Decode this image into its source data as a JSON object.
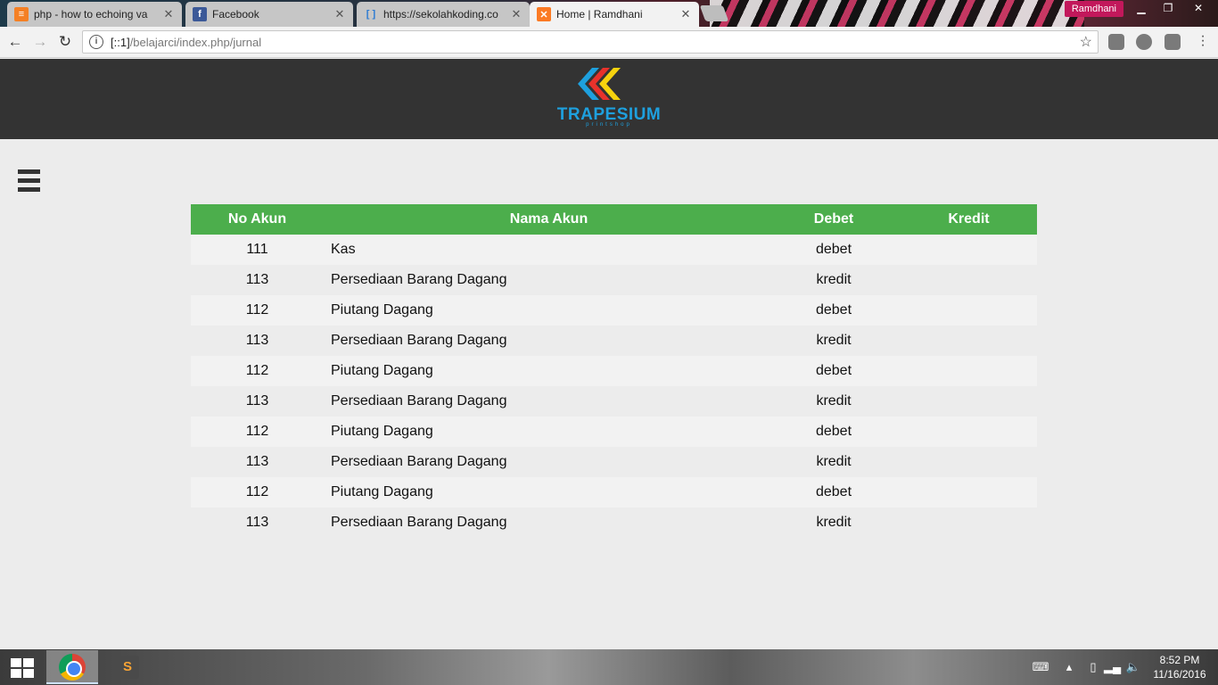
{
  "browser": {
    "tabs": [
      {
        "title": "php - how to echoing va",
        "favicon": "stackoverflow-icon",
        "active": false
      },
      {
        "title": "Facebook",
        "favicon": "facebook-icon",
        "active": false
      },
      {
        "title": "https://sekolahkoding.co",
        "favicon": "brackets-icon",
        "active": false
      },
      {
        "title": "Home | Ramdhani",
        "favicon": "xampp-icon",
        "active": true
      }
    ],
    "profile_name": "Ramdhani",
    "url_host": "[::1]",
    "url_path": "/belajarci/index.php/jurnal"
  },
  "site": {
    "logo_text": "TRAPESIUM",
    "logo_sub": "printshop"
  },
  "table": {
    "headers": {
      "no_akun": "No Akun",
      "nama_akun": "Nama Akun",
      "debet": "Debet",
      "kredit": "Kredit"
    },
    "rows": [
      {
        "no_akun": "111",
        "nama_akun": "Kas",
        "debet": "debet",
        "kredit": ""
      },
      {
        "no_akun": "113",
        "nama_akun": "Persediaan Barang Dagang",
        "debet": "kredit",
        "kredit": ""
      },
      {
        "no_akun": "112",
        "nama_akun": "Piutang Dagang",
        "debet": "debet",
        "kredit": ""
      },
      {
        "no_akun": "113",
        "nama_akun": "Persediaan Barang Dagang",
        "debet": "kredit",
        "kredit": ""
      },
      {
        "no_akun": "112",
        "nama_akun": "Piutang Dagang",
        "debet": "debet",
        "kredit": ""
      },
      {
        "no_akun": "113",
        "nama_akun": "Persediaan Barang Dagang",
        "debet": "kredit",
        "kredit": ""
      },
      {
        "no_akun": "112",
        "nama_akun": "Piutang Dagang",
        "debet": "debet",
        "kredit": ""
      },
      {
        "no_akun": "113",
        "nama_akun": "Persediaan Barang Dagang",
        "debet": "kredit",
        "kredit": ""
      },
      {
        "no_akun": "112",
        "nama_akun": "Piutang Dagang",
        "debet": "debet",
        "kredit": ""
      },
      {
        "no_akun": "113",
        "nama_akun": "Persediaan Barang Dagang",
        "debet": "kredit",
        "kredit": ""
      }
    ]
  },
  "taskbar": {
    "time": "8:52 PM",
    "date": "11/16/2016"
  },
  "colors": {
    "header_bg": "#333333",
    "table_header_bg": "#4cae4c",
    "logo_blue": "#1ea0de",
    "logo_red": "#e8322b",
    "logo_yellow": "#f6d30e"
  }
}
